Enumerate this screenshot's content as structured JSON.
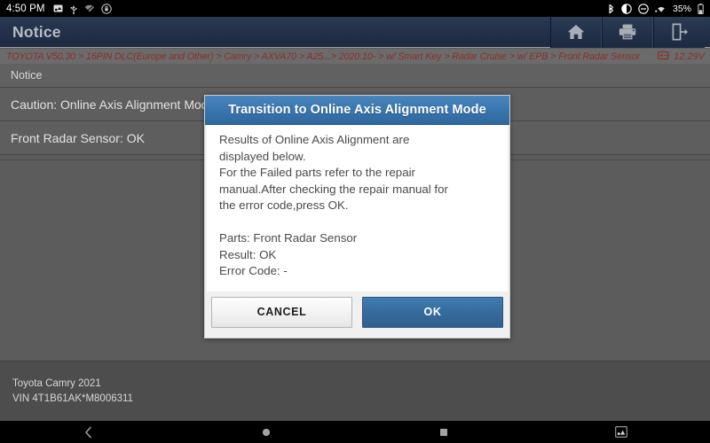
{
  "statusbar": {
    "time": "4:50 PM",
    "battery_percent": "35%",
    "left_icons": [
      "screenshot-icon",
      "usb-icon",
      "wifi-off-icon",
      "rotation-lock-icon"
    ],
    "right_icons": [
      "bluetooth-icon",
      "brightness-icon",
      "dnd-icon",
      "vpn-icon",
      "battery-icon"
    ]
  },
  "titlebar": {
    "title": "Notice",
    "buttons": [
      {
        "name": "home-button",
        "icon": "home-icon"
      },
      {
        "name": "print-button",
        "icon": "printer-icon"
      },
      {
        "name": "exit-button",
        "icon": "exit-icon"
      }
    ]
  },
  "breadcrumb": {
    "path": "TOYOTA V50.30 > 16PIN DLC(Europe and Other) > Camry > AXVA70 > A25...> 2020.10- > w/ Smart Key > Radar Cruise > w/ EPB > Front Radar Sensor",
    "voltage": "12.29V",
    "voltage_icon": "battery-icon",
    "text_color": "#8c2f28"
  },
  "list": {
    "header": "Notice",
    "rows": [
      {
        "label": "Caution: Online Axis Alignment Mode"
      },
      {
        "label": "Front Radar Sensor: OK"
      }
    ]
  },
  "dialog": {
    "title": "Transition to Online Axis Alignment Mode",
    "body_paragraph_1": "Results of Online Axis Alignment are\ndisplayed below.\nFor the Failed parts refer to the repair\nmanual.After checking the repair manual for\nthe error code,press OK.",
    "body_paragraph_2": "Parts: Front Radar Sensor\nResult: OK\nError Code: -",
    "cancel_label": "CANCEL",
    "ok_label": "OK",
    "title_color": "#3b77b0",
    "ok_color": "#36699c"
  },
  "footer": {
    "vehicle": "Toyota Camry 2021",
    "vin": "VIN 4T1B61AK*M8006311"
  },
  "navbar": {
    "buttons": [
      {
        "name": "nav-back-button",
        "icon": "chevron-left-icon"
      },
      {
        "name": "nav-home-button",
        "icon": "circle-icon"
      },
      {
        "name": "nav-recents-button",
        "icon": "square-icon"
      },
      {
        "name": "nav-screenshot-button",
        "icon": "screenshot-icon"
      }
    ]
  }
}
